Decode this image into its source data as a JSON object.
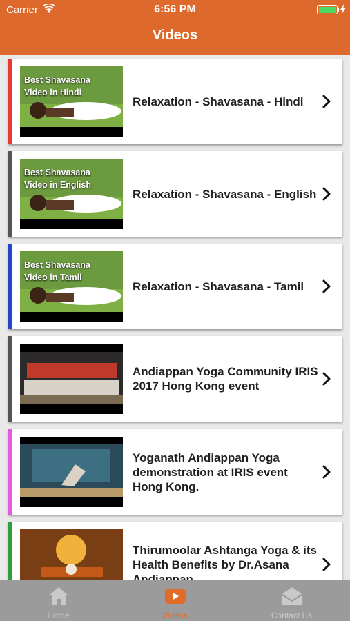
{
  "status_bar": {
    "carrier": "Carrier",
    "time": "6:56 PM"
  },
  "header": {
    "title": "Videos"
  },
  "videos": [
    {
      "title": "Relaxation - Shavasana - Hindi",
      "thumb_caption_1": "Best Shavasana",
      "thumb_caption_2": "Video in Hindi",
      "accent": "#e53935"
    },
    {
      "title": "Relaxation - Shavasana - English",
      "thumb_caption_1": "Best Shavasana",
      "thumb_caption_2": "Video in English",
      "accent": "#555555"
    },
    {
      "title": "Relaxation - Shavasana - Tamil",
      "thumb_caption_1": "Best Shavasana",
      "thumb_caption_2": "Video in Tamil",
      "accent": "#2346c9"
    },
    {
      "title": "Andiappan Yoga Community IRIS 2017 Hong Kong event",
      "accent": "#555555"
    },
    {
      "title": "Yoganath Andiappan Yoga demonstration at IRIS event Hong Kong.",
      "accent": "#e35be3"
    },
    {
      "title": "Thirumoolar Ashtanga Yoga & its Health Benefits by Dr.Asana Andiappan",
      "accent": "#2e9e3e"
    }
  ],
  "tabs": [
    {
      "label": "Home",
      "icon": "home-icon",
      "active": false
    },
    {
      "label": "Videos",
      "icon": "video-play-icon",
      "active": true
    },
    {
      "label": "Contact Us",
      "icon": "mail-icon",
      "active": false
    }
  ],
  "colors": {
    "header_bg": "#dd6a2c",
    "active_tab": "#e06c2a",
    "inactive_tab": "#c9c9c9"
  }
}
